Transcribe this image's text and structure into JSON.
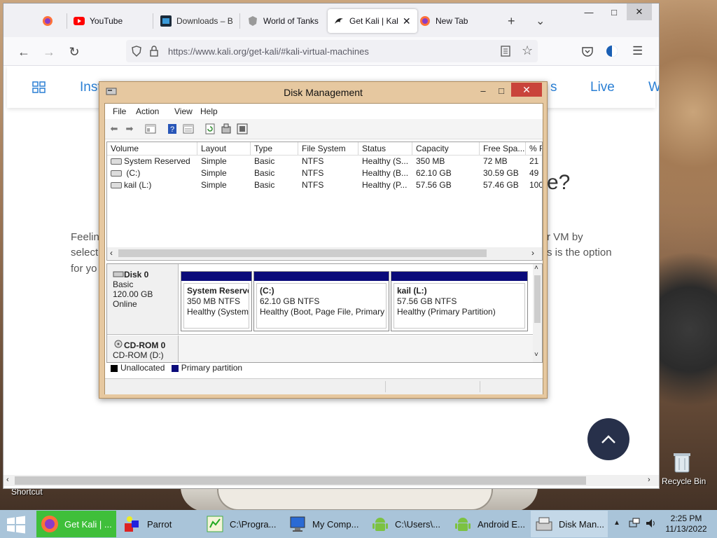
{
  "browser": {
    "tabs": [
      {
        "label": ""
      },
      {
        "label": "YouTube"
      },
      {
        "label": "Downloads – B"
      },
      {
        "label": "World of Tanks"
      },
      {
        "label": "Get Kali | Kal"
      },
      {
        "label": "New Tab"
      }
    ],
    "new_tab": "+",
    "tab_list": "⌄",
    "url": "https://www.kali.org/get-kali/#kali-virtual-machines"
  },
  "page": {
    "nav_links": [
      "Inst",
      "s",
      "Live",
      "W"
    ],
    "heading_tail": "e?",
    "para_left": [
      "Feelin",
      "select",
      "for yo"
    ],
    "para_right": [
      "r VM by",
      "s is the option"
    ]
  },
  "disk_mgmt": {
    "title": "Disk Management",
    "menu": [
      "File",
      "Action",
      "View",
      "Help"
    ],
    "columns": [
      "Volume",
      "Layout",
      "Type",
      "File System",
      "Status",
      "Capacity",
      "Free Spa...",
      "% F"
    ],
    "volumes": [
      {
        "volume": "System Reserved",
        "layout": "Simple",
        "type": "Basic",
        "fs": "NTFS",
        "status": "Healthy (S...",
        "capacity": "350 MB",
        "free": "72 MB",
        "pct": "21"
      },
      {
        "volume": " (C:)",
        "layout": "Simple",
        "type": "Basic",
        "fs": "NTFS",
        "status": "Healthy (B...",
        "capacity": "62.10 GB",
        "free": "30.59 GB",
        "pct": "49"
      },
      {
        "volume": "kail (L:)",
        "layout": "Simple",
        "type": "Basic",
        "fs": "NTFS",
        "status": "Healthy (P...",
        "capacity": "57.56 GB",
        "free": "57.46 GB",
        "pct": "100"
      }
    ],
    "disk0": {
      "name": "Disk 0",
      "kind": "Basic",
      "size": "120.00 GB",
      "state": "Online"
    },
    "partitions": [
      {
        "name": "System Reserve",
        "size": "350 MB NTFS",
        "status": "Healthy (System,"
      },
      {
        "name": " (C:)",
        "size": "62.10 GB NTFS",
        "status": "Healthy (Boot, Page File, Primary P"
      },
      {
        "name": "kail  (L:)",
        "size": "57.56 GB NTFS",
        "status": "Healthy (Primary Partition)"
      }
    ],
    "cdrom": {
      "name": "CD-ROM 0",
      "drive": "CD-ROM (D:)"
    },
    "legend": {
      "unallocated": "Unallocated",
      "primary": "Primary partition"
    },
    "colors": {
      "primary": "#0a0a7a",
      "unallocated": "#000000",
      "close": "#c9443b"
    }
  },
  "desktop": {
    "shortcut_label": "Shortcut",
    "recycle_bin": "Recycle Bin"
  },
  "taskbar": {
    "items": [
      "Get Kali | ...",
      "Parrot",
      "C:\\Progra...",
      "My Comp...",
      "C:\\Users\\...",
      "Android E...",
      "Disk Man..."
    ],
    "time": "2:25 PM",
    "date": "11/13/2022"
  }
}
